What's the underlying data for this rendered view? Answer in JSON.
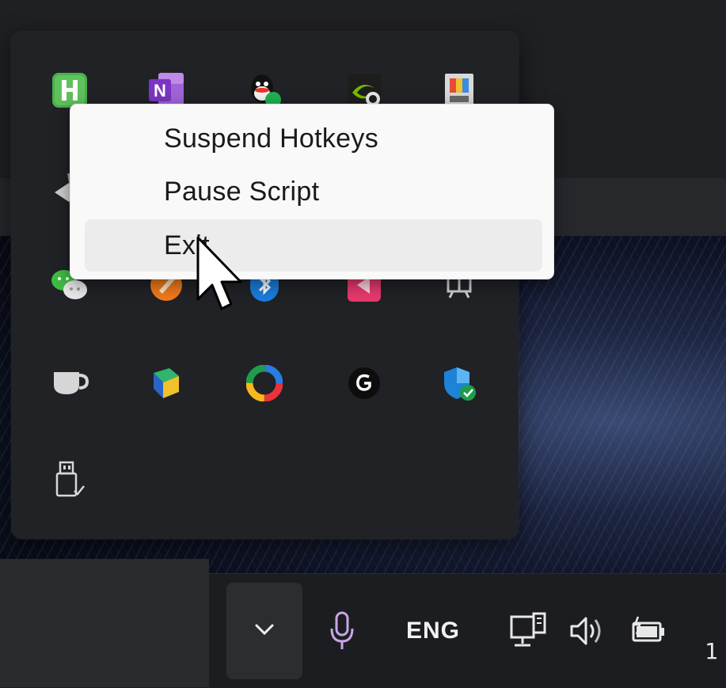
{
  "context_menu": {
    "items": [
      {
        "label": "Suspend Hotkeys"
      },
      {
        "label": "Pause Script"
      },
      {
        "label": "Exit"
      }
    ]
  },
  "tray_flyout": {
    "icons": [
      {
        "name": "hbuilder-icon"
      },
      {
        "name": "onenote-icon",
        "letter": "N"
      },
      {
        "name": "qq-icon"
      },
      {
        "name": "nvidia-icon"
      },
      {
        "name": "color-picker-icon"
      },
      {
        "name": "network-tray-icon"
      },
      {
        "name": "wechat-icon"
      },
      {
        "name": "orange-app-icon"
      },
      {
        "name": "bluetooth-icon"
      },
      {
        "name": "pink-app-icon"
      },
      {
        "name": "translator-app-icon"
      },
      {
        "name": "cup-icon"
      },
      {
        "name": "colored-app-icon"
      },
      {
        "name": "browser-ring-icon"
      },
      {
        "name": "logitech-g-icon"
      },
      {
        "name": "defender-shield-icon"
      },
      {
        "name": "usb-drive-icon"
      }
    ]
  },
  "taskbar": {
    "language": "ENG",
    "clock_partial": "1"
  },
  "colors": {
    "flyout_bg": "#202226",
    "menu_bg": "#f9f9f9",
    "menu_hover": "#ececec",
    "taskbar_bg": "#1c1d21",
    "mic_accent": "#c8a6e8"
  }
}
